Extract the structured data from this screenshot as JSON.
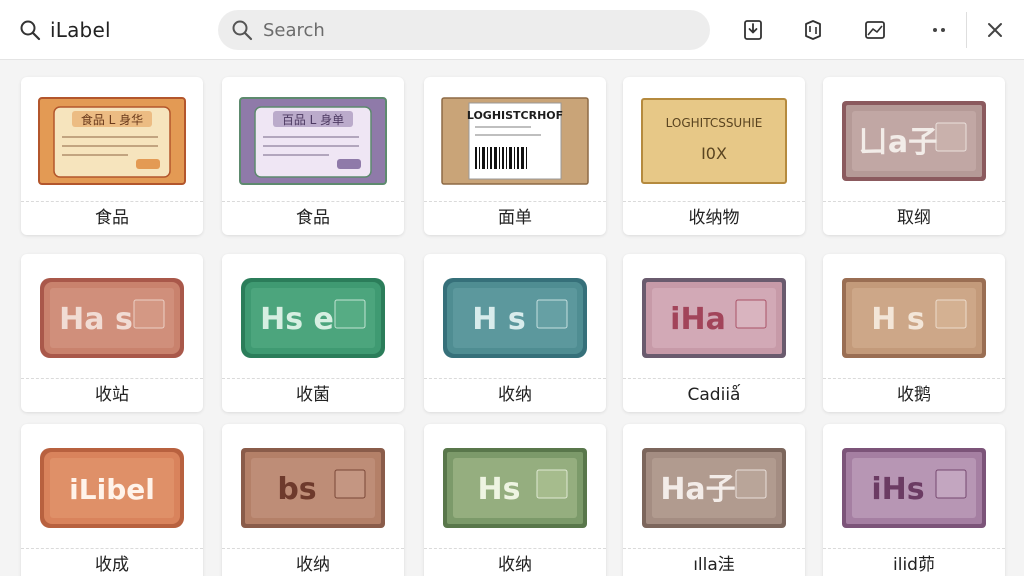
{
  "app": {
    "title": "iLabel",
    "icon": "search-icon"
  },
  "search": {
    "placeholder": "Search",
    "value": ""
  },
  "toolbar": [
    {
      "name": "import-icon"
    },
    {
      "name": "package-icon"
    },
    {
      "name": "image-icon"
    },
    {
      "name": "more-icon"
    },
    {
      "name": "close-icon"
    }
  ],
  "cards": [
    {
      "caption": "食品",
      "style": "food-orange",
      "title": "食品 L 身华"
    },
    {
      "caption": "食品",
      "style": "food-purple",
      "title": "百品 L 身单"
    },
    {
      "caption": "面单",
      "style": "logistics",
      "title": "LOGHISTCRHOF"
    },
    {
      "caption": "收纳物",
      "style": "gold",
      "title": "LOGHITCSSUHIE",
      "sub": "I0X"
    },
    {
      "caption": "取纲",
      "style": "mauve",
      "text": "ㄩa子"
    },
    {
      "caption": "收站",
      "style": "coral-tag",
      "text": "Ha s"
    },
    {
      "caption": "收菌",
      "style": "green-tag",
      "text": "Hs e"
    },
    {
      "caption": "收纳",
      "style": "teal-tag",
      "text": "H s"
    },
    {
      "caption": "Cadiiǻ",
      "style": "pink-tag",
      "text": "iHa"
    },
    {
      "caption": "收鹅",
      "style": "tan-tag",
      "text": "H s"
    },
    {
      "caption": "收成",
      "style": "orange-solid",
      "text": "iLibel"
    },
    {
      "caption": "收纳",
      "style": "brown-tag",
      "text": "bs"
    },
    {
      "caption": "收纳",
      "style": "olive-tag",
      "text": "Hs"
    },
    {
      "caption": "ılla洼",
      "style": "gray-tag",
      "text": "Ha子"
    },
    {
      "caption": "ilid茆",
      "style": "plum-tag",
      "text": "iHs"
    }
  ]
}
